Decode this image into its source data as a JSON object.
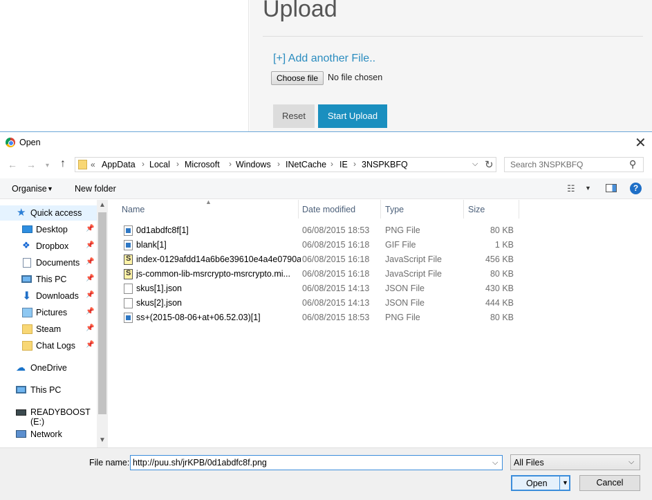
{
  "webpage": {
    "title": "Upload",
    "add_link": "[+] Add another File..",
    "choose_file": "Choose file",
    "no_file": "No file chosen",
    "reset": "Reset",
    "start_upload": "Start Upload"
  },
  "dialog": {
    "title": "Open",
    "close": "✕"
  },
  "address": {
    "overflow": "«",
    "crumbs": [
      "AppData",
      "Local",
      "Microsoft",
      "Windows",
      "INetCache",
      "IE",
      "3NSPKBFQ"
    ]
  },
  "search": {
    "placeholder": "Search 3NSPKBFQ"
  },
  "toolbar": {
    "organise": "Organise",
    "new_folder": "New folder",
    "help": "?"
  },
  "nav": {
    "items": [
      {
        "label": "Quick access",
        "icon": "star-icon"
      },
      {
        "label": "Desktop",
        "icon": "desktop-icon",
        "pinned": true
      },
      {
        "label": "Dropbox",
        "icon": "dropbox-icon",
        "pinned": true
      },
      {
        "label": "Documents",
        "icon": "documents-icon",
        "pinned": true
      },
      {
        "label": "This PC",
        "icon": "computer-icon",
        "pinned": true
      },
      {
        "label": "Downloads",
        "icon": "download-icon",
        "pinned": true
      },
      {
        "label": "Pictures",
        "icon": "pictures-icon",
        "pinned": true
      },
      {
        "label": "Steam",
        "icon": "folder-icon",
        "pinned": true
      },
      {
        "label": "Chat Logs",
        "icon": "folder-icon",
        "pinned": true
      },
      {
        "label": "OneDrive",
        "icon": "cloud-icon"
      },
      {
        "label": "This PC",
        "icon": "computer-icon"
      },
      {
        "label": "READYBOOST (E:)",
        "icon": "drive-icon"
      },
      {
        "label": "Network",
        "icon": "network-icon"
      }
    ]
  },
  "columns": {
    "name": "Name",
    "date": "Date modified",
    "type": "Type",
    "size": "Size"
  },
  "files": [
    {
      "name": "0d1abdfc8f[1]",
      "date": "06/08/2015 18:53",
      "type": "PNG File",
      "size": "80 KB",
      "icon": "image-file-icon"
    },
    {
      "name": "blank[1]",
      "date": "06/08/2015 16:18",
      "type": "GIF File",
      "size": "1 KB",
      "icon": "image-file-icon"
    },
    {
      "name": "index-0129afdd14a6b6e39610e4a4e0790a...",
      "date": "06/08/2015 16:18",
      "type": "JavaScript File",
      "size": "456 KB",
      "icon": "script-file-icon"
    },
    {
      "name": "js-common-lib-msrcrypto-msrcrypto.mi...",
      "date": "06/08/2015 16:18",
      "type": "JavaScript File",
      "size": "80 KB",
      "icon": "script-file-icon"
    },
    {
      "name": "skus[1].json",
      "date": "06/08/2015 14:13",
      "type": "JSON File",
      "size": "430 KB",
      "icon": "blank-file-icon"
    },
    {
      "name": "skus[2].json",
      "date": "06/08/2015 14:13",
      "type": "JSON File",
      "size": "444 KB",
      "icon": "blank-file-icon"
    },
    {
      "name": "ss+(2015-08-06+at+06.52.03)[1]",
      "date": "06/08/2015 18:53",
      "type": "PNG File",
      "size": "80 KB",
      "icon": "image-file-icon"
    }
  ],
  "footer": {
    "filename_label": "File name:",
    "filename_value": "http://puu.sh/jrKPB/0d1abdfc8f.png",
    "filetype": "All Files",
    "open": "Open",
    "cancel": "Cancel"
  },
  "colors": {
    "accent": "#1a8fbf",
    "link": "#2a8cbf",
    "selection": "#cce8ff"
  }
}
